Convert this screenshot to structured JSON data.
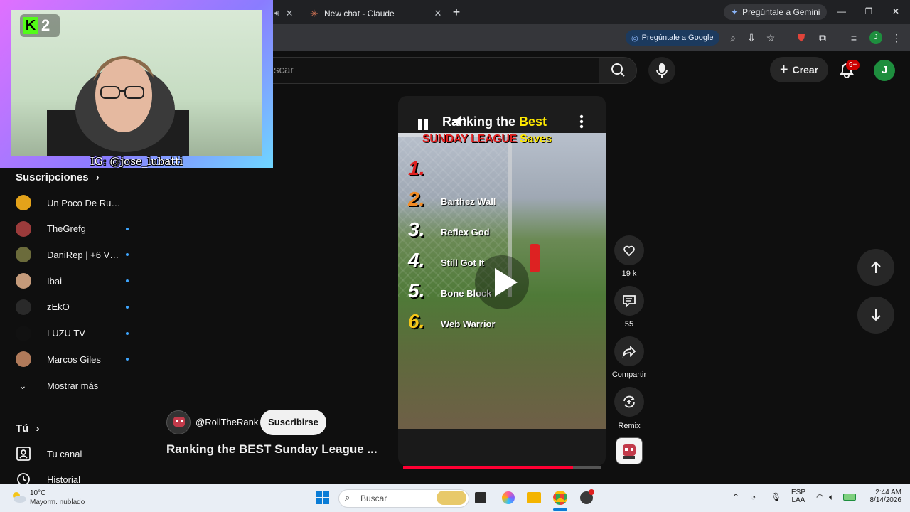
{
  "browser": {
    "tabs": [
      {
        "title": ""
      },
      {
        "title": "New chat - Claude"
      }
    ],
    "gemini_label": "Pregúntale a Gemini",
    "ask_google_label": "Pregúntale a Google",
    "profile_initial": "J",
    "extension_badge": "1"
  },
  "youtube": {
    "search_placeholder": "scar",
    "create_label": "Crear",
    "notifications_badge": "9+",
    "avatar_initial": "J"
  },
  "webcam": {
    "kick_number": "2",
    "ig_handle": "IG: @jose_lubatti"
  },
  "sidebar": {
    "subscriptions_heading": "Suscripciones",
    "subscriptions": [
      {
        "name": "Un Poco De Ruido",
        "new": false,
        "color": "#e3a21a"
      },
      {
        "name": "TheGrefg",
        "new": true,
        "color": "#9b3b3b"
      },
      {
        "name": "DaniRep | +6 Víd...",
        "new": true,
        "color": "#6b6b3b"
      },
      {
        "name": "Ibai",
        "new": true,
        "color": "#c49a7a"
      },
      {
        "name": "zEkO",
        "new": true,
        "color": "#2a2a2a"
      },
      {
        "name": "LUZU TV",
        "new": true,
        "color": "#111111"
      },
      {
        "name": "Marcos Giles",
        "new": true,
        "color": "#b07a5a"
      }
    ],
    "show_more": "Mostrar más",
    "you_heading": "Tú",
    "your_channel": "Tu canal",
    "history": "Historial"
  },
  "short": {
    "overlay_title_start": "Ranking the ",
    "overlay_title_hl": "Best",
    "overlay_sub_start": "SUNDAY LEAGUE ",
    "overlay_sub_hl": "Saves",
    "rankings": [
      {
        "num": "1.",
        "label": "",
        "color": "#e02020"
      },
      {
        "num": "2.",
        "label": "Barthez Wall",
        "color": "#f08a24"
      },
      {
        "num": "3.",
        "label": "Reflex God",
        "color": "#ffffff"
      },
      {
        "num": "4.",
        "label": "Still Got It",
        "color": "#ffffff"
      },
      {
        "num": "5.",
        "label": "Bone Block",
        "color": "#ffffff"
      },
      {
        "num": "6.",
        "label": "Web Warrior",
        "color": "#f5c518"
      }
    ],
    "likes": "19 k",
    "comments": "55",
    "share_label": "Compartir",
    "remix_label": "Remix",
    "progress": 0.86,
    "channel": "@RollTheRank",
    "subscribe_label": "Suscribirse",
    "title": "Ranking the BEST Sunday League ..."
  },
  "taskbar": {
    "temp": "10°C",
    "weather": "Mayorm. nublado",
    "search_placeholder": "Buscar",
    "lang1": "ESP",
    "lang2": "LAA",
    "time": "2:44 AM",
    "date": "8/14/2026"
  }
}
